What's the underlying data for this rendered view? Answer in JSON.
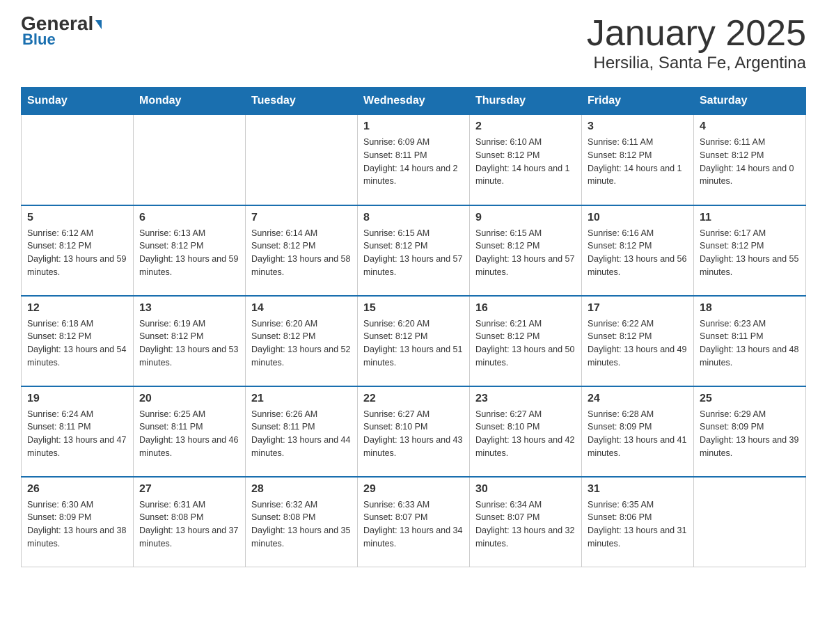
{
  "header": {
    "logo_general": "General",
    "logo_blue": "Blue",
    "title": "January 2025",
    "subtitle": "Hersilia, Santa Fe, Argentina"
  },
  "days_of_week": [
    "Sunday",
    "Monday",
    "Tuesday",
    "Wednesday",
    "Thursday",
    "Friday",
    "Saturday"
  ],
  "weeks": [
    [
      {
        "num": "",
        "info": ""
      },
      {
        "num": "",
        "info": ""
      },
      {
        "num": "",
        "info": ""
      },
      {
        "num": "1",
        "info": "Sunrise: 6:09 AM\nSunset: 8:11 PM\nDaylight: 14 hours and 2 minutes."
      },
      {
        "num": "2",
        "info": "Sunrise: 6:10 AM\nSunset: 8:12 PM\nDaylight: 14 hours and 1 minute."
      },
      {
        "num": "3",
        "info": "Sunrise: 6:11 AM\nSunset: 8:12 PM\nDaylight: 14 hours and 1 minute."
      },
      {
        "num": "4",
        "info": "Sunrise: 6:11 AM\nSunset: 8:12 PM\nDaylight: 14 hours and 0 minutes."
      }
    ],
    [
      {
        "num": "5",
        "info": "Sunrise: 6:12 AM\nSunset: 8:12 PM\nDaylight: 13 hours and 59 minutes."
      },
      {
        "num": "6",
        "info": "Sunrise: 6:13 AM\nSunset: 8:12 PM\nDaylight: 13 hours and 59 minutes."
      },
      {
        "num": "7",
        "info": "Sunrise: 6:14 AM\nSunset: 8:12 PM\nDaylight: 13 hours and 58 minutes."
      },
      {
        "num": "8",
        "info": "Sunrise: 6:15 AM\nSunset: 8:12 PM\nDaylight: 13 hours and 57 minutes."
      },
      {
        "num": "9",
        "info": "Sunrise: 6:15 AM\nSunset: 8:12 PM\nDaylight: 13 hours and 57 minutes."
      },
      {
        "num": "10",
        "info": "Sunrise: 6:16 AM\nSunset: 8:12 PM\nDaylight: 13 hours and 56 minutes."
      },
      {
        "num": "11",
        "info": "Sunrise: 6:17 AM\nSunset: 8:12 PM\nDaylight: 13 hours and 55 minutes."
      }
    ],
    [
      {
        "num": "12",
        "info": "Sunrise: 6:18 AM\nSunset: 8:12 PM\nDaylight: 13 hours and 54 minutes."
      },
      {
        "num": "13",
        "info": "Sunrise: 6:19 AM\nSunset: 8:12 PM\nDaylight: 13 hours and 53 minutes."
      },
      {
        "num": "14",
        "info": "Sunrise: 6:20 AM\nSunset: 8:12 PM\nDaylight: 13 hours and 52 minutes."
      },
      {
        "num": "15",
        "info": "Sunrise: 6:20 AM\nSunset: 8:12 PM\nDaylight: 13 hours and 51 minutes."
      },
      {
        "num": "16",
        "info": "Sunrise: 6:21 AM\nSunset: 8:12 PM\nDaylight: 13 hours and 50 minutes."
      },
      {
        "num": "17",
        "info": "Sunrise: 6:22 AM\nSunset: 8:12 PM\nDaylight: 13 hours and 49 minutes."
      },
      {
        "num": "18",
        "info": "Sunrise: 6:23 AM\nSunset: 8:11 PM\nDaylight: 13 hours and 48 minutes."
      }
    ],
    [
      {
        "num": "19",
        "info": "Sunrise: 6:24 AM\nSunset: 8:11 PM\nDaylight: 13 hours and 47 minutes."
      },
      {
        "num": "20",
        "info": "Sunrise: 6:25 AM\nSunset: 8:11 PM\nDaylight: 13 hours and 46 minutes."
      },
      {
        "num": "21",
        "info": "Sunrise: 6:26 AM\nSunset: 8:11 PM\nDaylight: 13 hours and 44 minutes."
      },
      {
        "num": "22",
        "info": "Sunrise: 6:27 AM\nSunset: 8:10 PM\nDaylight: 13 hours and 43 minutes."
      },
      {
        "num": "23",
        "info": "Sunrise: 6:27 AM\nSunset: 8:10 PM\nDaylight: 13 hours and 42 minutes."
      },
      {
        "num": "24",
        "info": "Sunrise: 6:28 AM\nSunset: 8:09 PM\nDaylight: 13 hours and 41 minutes."
      },
      {
        "num": "25",
        "info": "Sunrise: 6:29 AM\nSunset: 8:09 PM\nDaylight: 13 hours and 39 minutes."
      }
    ],
    [
      {
        "num": "26",
        "info": "Sunrise: 6:30 AM\nSunset: 8:09 PM\nDaylight: 13 hours and 38 minutes."
      },
      {
        "num": "27",
        "info": "Sunrise: 6:31 AM\nSunset: 8:08 PM\nDaylight: 13 hours and 37 minutes."
      },
      {
        "num": "28",
        "info": "Sunrise: 6:32 AM\nSunset: 8:08 PM\nDaylight: 13 hours and 35 minutes."
      },
      {
        "num": "29",
        "info": "Sunrise: 6:33 AM\nSunset: 8:07 PM\nDaylight: 13 hours and 34 minutes."
      },
      {
        "num": "30",
        "info": "Sunrise: 6:34 AM\nSunset: 8:07 PM\nDaylight: 13 hours and 32 minutes."
      },
      {
        "num": "31",
        "info": "Sunrise: 6:35 AM\nSunset: 8:06 PM\nDaylight: 13 hours and 31 minutes."
      },
      {
        "num": "",
        "info": ""
      }
    ]
  ]
}
